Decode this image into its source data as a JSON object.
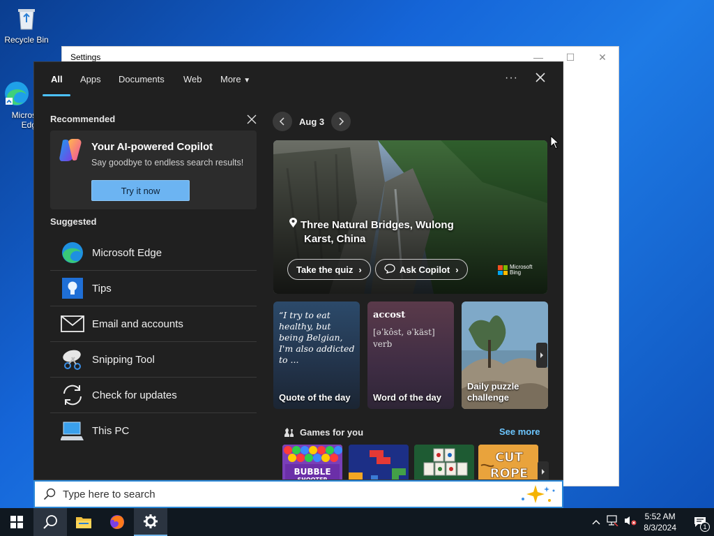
{
  "desktop": {
    "icons": [
      {
        "label": "Recycle Bin"
      },
      {
        "label": "Microsoft Edge",
        "visible_label_part1": "Micros",
        "visible_label_part2": "Edg"
      }
    ]
  },
  "settings_window": {
    "title": "Settings"
  },
  "search_panel": {
    "tabs": [
      "All",
      "Apps",
      "Documents",
      "Web",
      "More"
    ],
    "active_tab": "All",
    "recommended": {
      "heading": "Recommended",
      "card_title": "Your AI-powered Copilot",
      "card_subtitle": "Say goodbye to endless search results!",
      "button": "Try it now"
    },
    "suggested": {
      "heading": "Suggested",
      "items": [
        {
          "label": "Microsoft Edge",
          "icon": "edge-icon"
        },
        {
          "label": "Tips",
          "icon": "tips-icon"
        },
        {
          "label": "Email and accounts",
          "icon": "mail-icon"
        },
        {
          "label": "Snipping Tool",
          "icon": "snipping-tool-icon"
        },
        {
          "label": "Check for updates",
          "icon": "refresh-icon"
        },
        {
          "label": "This PC",
          "icon": "computer-icon"
        }
      ]
    },
    "highlights": {
      "date": "Aug 3",
      "hero": {
        "location_line1": "Three Natural Bridges, Wulong",
        "location_line2": "Karst, China",
        "quiz_button": "Take the quiz",
        "copilot_button": "Ask Copilot",
        "brand_line1": "Microsoft",
        "brand_line2": "Bing"
      },
      "cards": [
        {
          "caption": "Quote of the day",
          "text": "“I try to eat healthy, but being Belgian, I'm also addicted to ..."
        },
        {
          "caption": "Word of the day",
          "word": "accost",
          "pronunciation": "[əˈkôst, əˈkäst]",
          "pos": "verb"
        },
        {
          "caption_line1": "Daily puzzle",
          "caption_line2": "challenge"
        }
      ],
      "games": {
        "heading": "Games for you",
        "see_more": "See more"
      }
    }
  },
  "search_box": {
    "placeholder": "Type here to search"
  },
  "taskbar": {
    "time": "5:52 AM",
    "date": "8/3/2024",
    "notification_count": "1",
    "colors": {
      "accent": "#4cc2ff",
      "taskbar": "#101820"
    }
  }
}
